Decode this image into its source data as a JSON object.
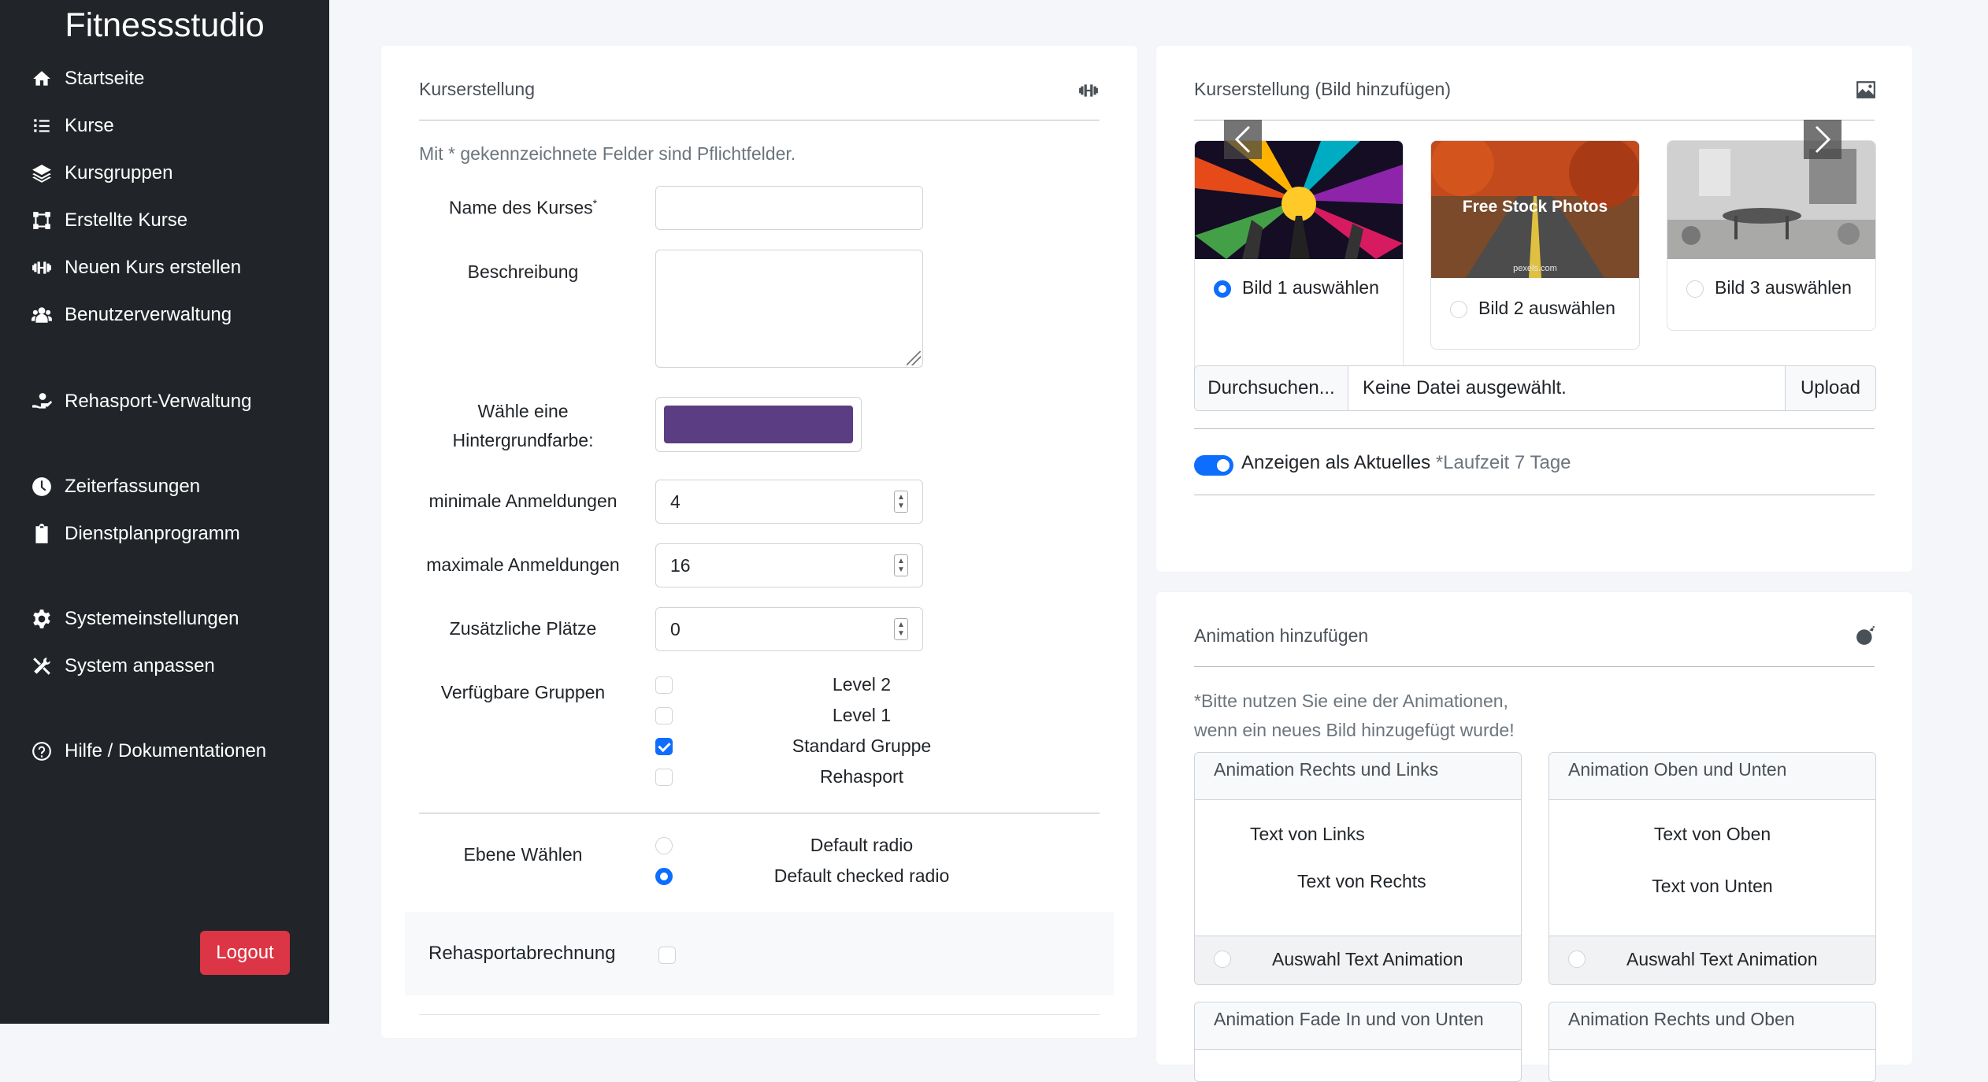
{
  "sidebar": {
    "brand": "Fitnessstudio",
    "items": [
      {
        "label": "Startseite",
        "icon": "home-icon"
      },
      {
        "label": "Kurse",
        "icon": "list-icon"
      },
      {
        "label": "Kursgruppen",
        "icon": "layers-icon"
      },
      {
        "label": "Erstellte Kurse",
        "icon": "vector-square-icon"
      },
      {
        "label": "Neuen Kurs erstellen",
        "icon": "dumbbell-icon"
      },
      {
        "label": "Benutzerverwaltung",
        "icon": "users-icon"
      },
      {
        "label": "Rehasport-Verwaltung",
        "icon": "hand-holding-icon"
      },
      {
        "label": "Zeiterfassungen",
        "icon": "clock-icon"
      },
      {
        "label": "Dienstplanprogramm",
        "icon": "clipboard-icon"
      },
      {
        "label": "Systemeinstellungen",
        "icon": "gear-icon"
      },
      {
        "label": "System anpassen",
        "icon": "tools-icon"
      },
      {
        "label": "Hilfe / Dokumentationen",
        "icon": "question-circle-icon"
      }
    ],
    "logout_label": "Logout"
  },
  "course_form": {
    "title": "Kurserstellung",
    "required_note": "Mit * gekennzeichnete Felder sind Pflichtfelder.",
    "name_label": "Name des Kurses",
    "name_required_mark": "*",
    "name_value": "",
    "description_label": "Beschreibung",
    "description_value": "",
    "bgcolor_label_line1": "Wähle eine",
    "bgcolor_label_line2": "Hintergrundfarbe:",
    "bgcolor_value": "#5a3d82",
    "min_label": "minimale Anmeldungen",
    "min_value": "4",
    "max_label": "maximale Anmeldungen",
    "max_value": "16",
    "extra_label": "Zusätzliche Plätze",
    "extra_value": "0",
    "groups_label": "Verfügbare Gruppen",
    "groups": [
      {
        "label": "Level 2",
        "checked": false
      },
      {
        "label": "Level 1",
        "checked": false
      },
      {
        "label": "Standard Gruppe",
        "checked": true
      },
      {
        "label": "Rehasport",
        "checked": false
      }
    ],
    "level_label": "Ebene Wählen",
    "radios": [
      {
        "label": "Default radio",
        "checked": false
      },
      {
        "label": "Default checked radio",
        "checked": true
      }
    ],
    "rehasport_billing_label": "Rehasportabrechnung",
    "rehasport_billing_checked": false
  },
  "image_card": {
    "title": "Kurserstellung (Bild hinzufügen)",
    "images": [
      {
        "label": "Bild 1 auswählen",
        "checked": true
      },
      {
        "label": "Bild 2 auswählen",
        "checked": false,
        "overlay_text": "Free Stock Photos",
        "watermark": "pexels.com"
      },
      {
        "label": "Bild 3 auswählen",
        "checked": false
      }
    ],
    "browse_label": "Durchsuchen...",
    "file_status": "Keine Datei ausgewählt.",
    "upload_label": "Upload",
    "toggle_label": "Anzeigen als Aktuelles",
    "toggle_note": "*Laufzeit 7 Tage",
    "toggle_on": true
  },
  "animation_card": {
    "title": "Animation hinzufügen",
    "hint_line1": "*Bitte nutzen Sie eine der Animationen,",
    "hint_line2": "wenn ein neues Bild hinzugefügt wurde!",
    "boxes": [
      {
        "title": "Animation Rechts und Links",
        "text1": "Text von Links",
        "text2": "Text von Rechts",
        "footer": "Auswahl Text Animation"
      },
      {
        "title": "Animation Oben und Unten",
        "text1": "Text von Oben",
        "text2": "Text von Unten",
        "footer": "Auswahl Text Animation"
      },
      {
        "title": "Animation Fade In und von Unten"
      },
      {
        "title": "Animation Rechts und Oben"
      }
    ]
  },
  "colors": {
    "sidebar_bg": "#212529",
    "accent": "#0d6efd",
    "danger": "#dc3545",
    "page_bg": "#f5f6fa"
  }
}
